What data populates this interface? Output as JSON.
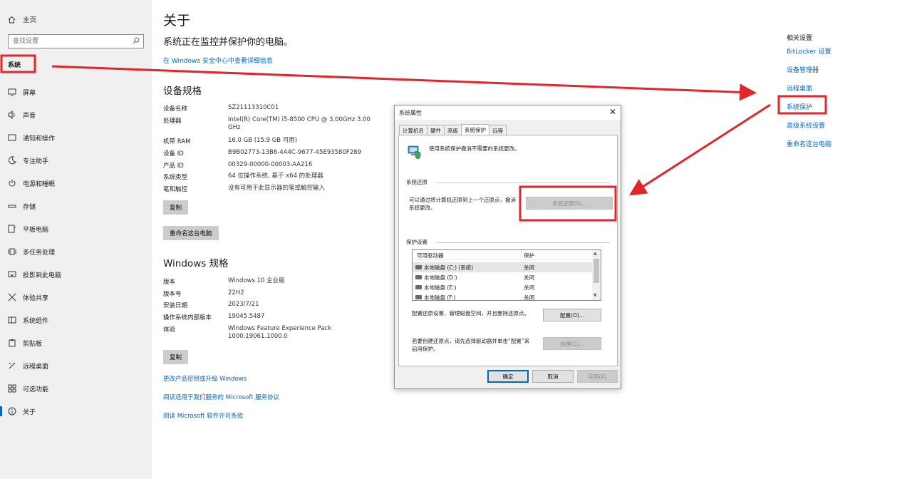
{
  "sidebar": {
    "home": "主页",
    "search_placeholder": "查找设置",
    "section": "系统",
    "items": [
      {
        "label": "屏幕",
        "icon": "display-icon"
      },
      {
        "label": "声音",
        "icon": "speaker-icon"
      },
      {
        "label": "通知和操作",
        "icon": "notification-icon"
      },
      {
        "label": "专注助手",
        "icon": "moon-icon"
      },
      {
        "label": "电源和睡眠",
        "icon": "power-icon"
      },
      {
        "label": "存储",
        "icon": "storage-icon"
      },
      {
        "label": "平板电脑",
        "icon": "tablet-icon"
      },
      {
        "label": "多任务处理",
        "icon": "multitask-icon"
      },
      {
        "label": "投影到此电脑",
        "icon": "project-icon"
      },
      {
        "label": "体验共享",
        "icon": "share-icon"
      },
      {
        "label": "系统组件",
        "icon": "components-icon"
      },
      {
        "label": "剪贴板",
        "icon": "clipboard-icon"
      },
      {
        "label": "远程桌面",
        "icon": "remote-icon"
      },
      {
        "label": "可选功能",
        "icon": "features-icon"
      },
      {
        "label": "关于",
        "icon": "info-icon"
      }
    ]
  },
  "main": {
    "title": "关于",
    "status": "系统正在监控并保护你的电脑。",
    "security_link": "在 Windows 安全中心中查看详细信息",
    "device_specs_title": "设备规格",
    "device_specs": [
      {
        "k": "设备名称",
        "v": "SZ21113310C01"
      },
      {
        "k": "处理器",
        "v": "Intel(R) Core(TM) i5-8500 CPU @ 3.00GHz   3.00 GHz"
      },
      {
        "k": "机带 RAM",
        "v": "16.0 GB (15.9 GB 可用)"
      },
      {
        "k": "设备 ID",
        "v": "B9B02773-13B6-4A4C-9677-45E93580F289"
      },
      {
        "k": "产品 ID",
        "v": "00329-00000-00003-AA216"
      },
      {
        "k": "系统类型",
        "v": "64 位操作系统, 基于 x64 的处理器"
      },
      {
        "k": "笔和触控",
        "v": "没有可用于此显示器的笔或触控输入"
      }
    ],
    "copy1": "复制",
    "rename": "重命名这台电脑",
    "windows_specs_title": "Windows 规格",
    "windows_specs": [
      {
        "k": "版本",
        "v": "Windows 10 企业版"
      },
      {
        "k": "版本号",
        "v": "22H2"
      },
      {
        "k": "安装日期",
        "v": "2023/7/21"
      },
      {
        "k": "操作系统内部版本",
        "v": "19045.5487"
      },
      {
        "k": "体验",
        "v": "Windows Feature Experience Pack 1000.19061.1000.0"
      }
    ],
    "copy2": "复制",
    "links": [
      "更改产品密钥或升级 Windows",
      "阅读适用于我们服务的 Microsoft 服务协议",
      "阅读 Microsoft 软件许可条款"
    ]
  },
  "related": {
    "title": "相关设置",
    "links": [
      "BitLocker 设置",
      "设备管理器",
      "远程桌面",
      "系统保护",
      "高级系统设置",
      "重命名这台电脑"
    ]
  },
  "dialog": {
    "title": "系统属性",
    "close": "✕",
    "tabs": [
      "计算机名",
      "硬件",
      "高级",
      "系统保护",
      "远程"
    ],
    "intro": "使用系统保护撤消不需要的系统更改。",
    "restore_group": "系统还原",
    "restore_text_1": "可以通过将计算机还原到上一个还原点，撤消",
    "restore_text_2": "系统更改。",
    "restore_btn": "系统还原(S)...",
    "protect_group": "保护设置",
    "col_drive": "可用驱动器",
    "col_protect": "保护",
    "drives": [
      {
        "name": "本地磁盘 (C:) (系统)",
        "protect": "关闭"
      },
      {
        "name": "本地磁盘 (D:)",
        "protect": "关闭"
      },
      {
        "name": "本地磁盘 (E:)",
        "protect": "关闭"
      },
      {
        "name": "本地磁盘 (F:)",
        "protect": "关闭"
      }
    ],
    "config_text": "配置还原设置、管理磁盘空间，并且删除还原点。",
    "config_btn": "配置(O)...",
    "create_text_1": "若要创建还原点，请先选择驱动器并单击“配置”来",
    "create_text_2": "启用保护。",
    "create_btn": "创建(C)...",
    "ok": "确定",
    "cancel": "取消",
    "apply": "应用(A)"
  },
  "annotation_color": "#e0262b"
}
